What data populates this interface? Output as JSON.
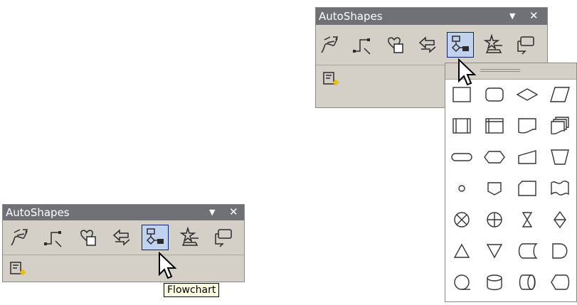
{
  "small_toolbar": {
    "title": "AutoShapes",
    "dropdown_glyph": "▼",
    "close_glyph": "✕",
    "icons": [
      "lines-icon",
      "connectors-icon",
      "basic-shapes-icon",
      "block-arrows-icon",
      "flowchart-icon",
      "stars-banners-icon",
      "callouts-icon"
    ],
    "more_icon": "more-autoshapes-icon",
    "tooltip": "Flowchart",
    "active_icon": "flowchart-icon"
  },
  "large_toolbar": {
    "title": "AutoShapes",
    "dropdown_glyph": "▼",
    "close_glyph": "✕",
    "icons": [
      "lines-icon",
      "connectors-icon",
      "basic-shapes-icon",
      "block-arrows-icon",
      "flowchart-icon",
      "stars-banners-icon",
      "callouts-icon"
    ],
    "more_icon": "more-autoshapes-icon",
    "active_icon": "flowchart-icon"
  },
  "flowchart_menu": {
    "shapes": [
      "process",
      "alternate-process",
      "decision",
      "data",
      "predefined-process",
      "internal-storage",
      "document",
      "multidocument",
      "terminator",
      "preparation",
      "manual-input",
      "manual-operation",
      "connector",
      "off-page-connector",
      "card",
      "punched-tape",
      "summing-junction",
      "or",
      "collate",
      "sort",
      "extract",
      "merge",
      "stored-data",
      "delay",
      "sequential-access-storage",
      "magnetic-disk",
      "direct-access-storage",
      "display"
    ]
  }
}
